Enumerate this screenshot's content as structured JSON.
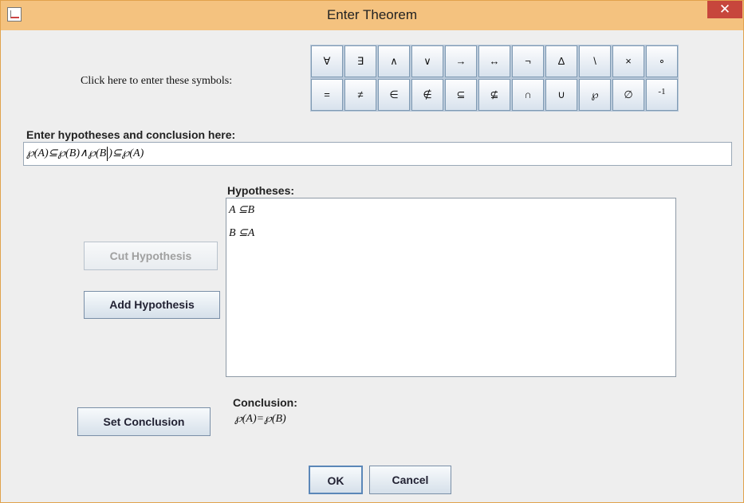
{
  "window": {
    "title": "Enter Theorem",
    "close_glyph": "✕",
    "app_icon": "java-icon"
  },
  "symbols": {
    "prompt": "Click here to enter these symbols:",
    "row1": [
      "∀",
      "∃",
      "∧",
      "∨",
      "→",
      "↔",
      "¬",
      "Δ",
      "\\",
      "×",
      "∘"
    ],
    "row2": [
      "=",
      "≠",
      "∈",
      "∉",
      "⊆",
      "⊈",
      "∩",
      "∪",
      "℘",
      "∅",
      "-1"
    ]
  },
  "main": {
    "label": "Enter hypotheses and conclusion here:",
    "input_before_caret": "℘(A)⊆℘(B)∧℘(B",
    "input_after_caret": ")⊆℘(A)"
  },
  "hypotheses": {
    "label": "Hypotheses:",
    "items": [
      "A ⊆B",
      "B ⊆A"
    ]
  },
  "buttons": {
    "cut": "Cut Hypothesis",
    "add": "Add Hypothesis",
    "set_conclusion": "Set Conclusion",
    "ok": "OK",
    "cancel": "Cancel"
  },
  "conclusion": {
    "label": "Conclusion:",
    "value": "℘(A)=℘(B)"
  }
}
